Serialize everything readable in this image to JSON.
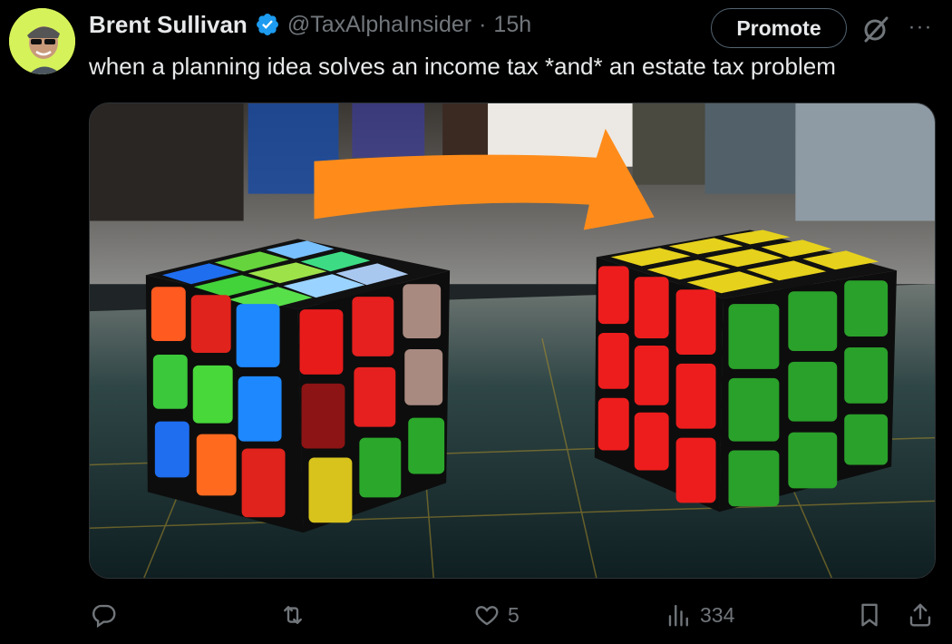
{
  "tweet": {
    "author_name": "Brent Sullivan",
    "handle": "@TaxAlphaInsider",
    "separator": "·",
    "time": "15h",
    "text": "when a planning idea solves an income tax *and* an estate tax problem",
    "promote_label": "Promote",
    "more_label": "···"
  },
  "actions": {
    "likes": "5",
    "views": "334"
  },
  "colors": {
    "verified": "#1d9bf0",
    "avatar_bg": "#d6f25a",
    "muted": "#71767b",
    "arrow": "#ff8c1a"
  },
  "icons": [
    "reply-icon",
    "retweet-icon",
    "like-icon",
    "views-icon",
    "bookmark-icon",
    "share-icon",
    "verified-badge-icon",
    "grok-icon",
    "more-icon"
  ]
}
